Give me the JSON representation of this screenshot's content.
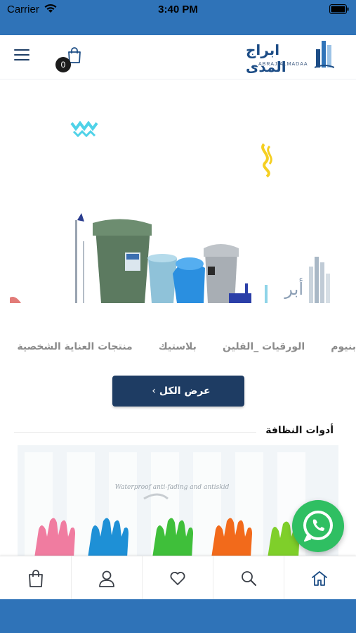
{
  "status_bar": {
    "carrier": "Carrier",
    "time": "3:40 PM"
  },
  "header": {
    "cart_count": "0",
    "logo_text_ar": "ابراج المدى",
    "logo_text_en": "ABRAJ ALMADAA"
  },
  "banner": {
    "brand_mark_text": "أبر"
  },
  "categories": [
    "منتجات العناية الشخصية",
    "بلاستيك",
    "الورقيات _الفلين",
    "بنيوم"
  ],
  "view_all_label": "عرض الكل",
  "section": {
    "title": "أدوات النظافة",
    "image_caption": "Waterproof anti-fading and antiskid"
  },
  "tabs": [
    {
      "name": "cart",
      "icon": "shopping-bag-icon"
    },
    {
      "name": "account",
      "icon": "user-icon"
    },
    {
      "name": "wishlist",
      "icon": "heart-icon"
    },
    {
      "name": "search",
      "icon": "search-icon"
    },
    {
      "name": "home",
      "icon": "home-icon"
    }
  ],
  "colors": {
    "brand_blue": "#2f73b8",
    "button_navy": "#1e3c63",
    "whatsapp_green": "#2fbf62",
    "tab_icon": "#3a3f47",
    "active_tab_icon": "#1f4f86"
  }
}
